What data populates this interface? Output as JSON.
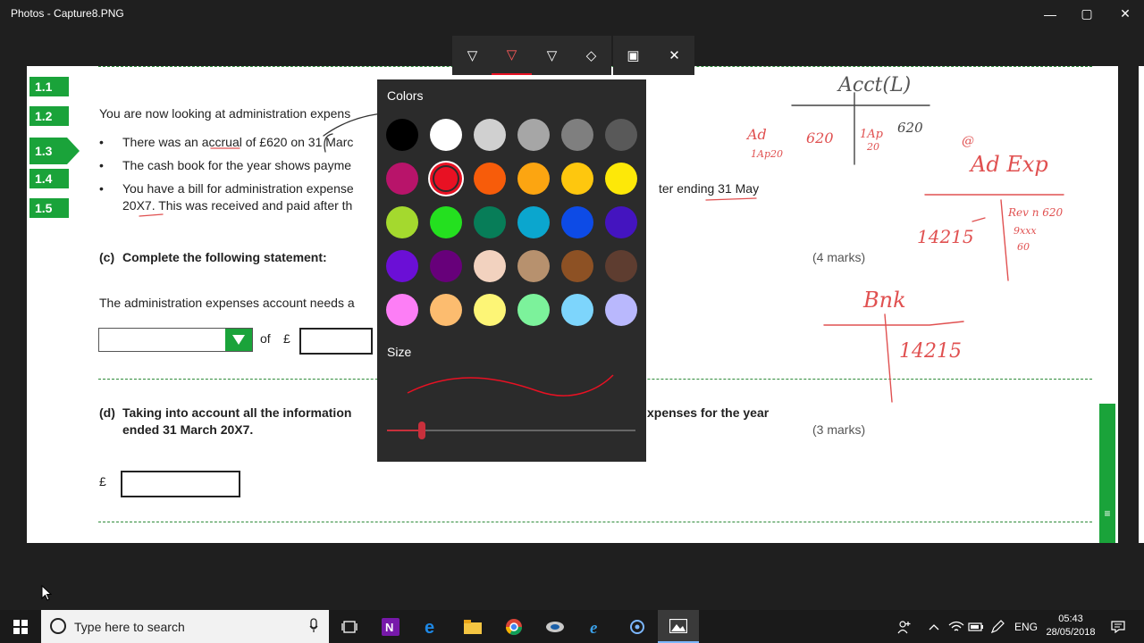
{
  "window": {
    "title": "Photos - Capture8.PNG",
    "minimize": "—",
    "maximize": "▢",
    "close": "✕"
  },
  "ink_toolbar": {
    "ballpoint_icon": "▽",
    "pencil_icon": "▽",
    "highlighter_icon": "▽",
    "eraser_icon": "◇",
    "save_icon": "▣",
    "close_icon": "✕"
  },
  "color_picker": {
    "colors_heading": "Colors",
    "size_heading": "Size",
    "selected_color": "#e81123",
    "size_level": 0.14,
    "swatches": [
      "#000000",
      "#ffffff",
      "#d0d0d0",
      "#a6a6a6",
      "#7f7f7f",
      "#595959",
      "#b8146a",
      "#e81123",
      "#f75c0a",
      "#fca511",
      "#fec70e",
      "#fde808",
      "#a4d92e",
      "#24e01f",
      "#077d58",
      "#0ba6ce",
      "#0d4be6",
      "#4414bf",
      "#6b0fd6",
      "#67007a",
      "#f2d2bf",
      "#b7916e",
      "#8d5124",
      "#5e3d30",
      "#fd7ef6",
      "#fcbc6f",
      "#fdf576",
      "#7cf29b",
      "#7dd5fc",
      "#b9b8fd"
    ]
  },
  "document": {
    "nav_tabs": [
      "1.1",
      "1.2",
      "1.3",
      "1.4",
      "1.5"
    ],
    "intro": "You are now looking at administration expens",
    "bullets": [
      "There was an accrual of £620 on 31 Marc",
      "The cash book for the year shows payme",
      "You have a bill for administration expense"
    ],
    "bullet3_line2": "20X7. This was received and paid after th",
    "bullet3_tail": "ter ending 31 May",
    "part_c_label": "(c)",
    "part_c_text": "Complete the following statement:",
    "part_c_marks": "(4 marks)",
    "statement": "The administration expenses account needs a",
    "of_label": "of",
    "pound_label": "£",
    "part_d_label": "(d)",
    "part_d_text": "Taking into account all the information",
    "part_d_tail": "xpenses for the year",
    "part_d_line2": "ended 31 March 20X7.",
    "part_d_marks": "(3 marks)",
    "answer_pound": "£",
    "scroll_grip": "≡"
  },
  "annotations": {
    "t1_header": "Acct(L)",
    "t1_left_top": "Ad",
    "t1_left_sub": "1Ap20",
    "t1_left_amount": "620",
    "t1_right_top": "1Ap",
    "t1_right_sub": "20",
    "t1_right_amount": "620",
    "t2_mark": "@",
    "t2_header": "Ad Exp",
    "t2_left_amount": "14215",
    "t2_right_top": "Rev n 620",
    "t2_right_mid": "9xxx",
    "t2_right_bot": "60",
    "t3_header": "Bnk",
    "t3_amount": "14215"
  },
  "taskbar": {
    "search_placeholder": "Type here to search",
    "language": "ENG",
    "time": "05:43",
    "date": "28/05/2018"
  }
}
